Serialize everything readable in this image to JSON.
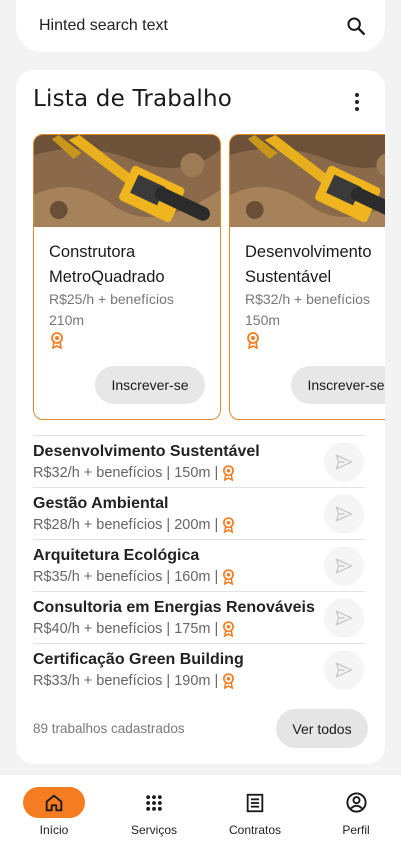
{
  "search": {
    "placeholder": "Hinted search text",
    "icon": "search-icon"
  },
  "panel": {
    "title": "Lista de Trabalho",
    "menu_icon": "more-vertical-icon",
    "featured": [
      {
        "title": "Construtora MetroQuadrado",
        "pay": "R$25/h + benefícios",
        "distance": "210m",
        "badge_icon": "award-icon",
        "apply_label": "Inscrever-se"
      },
      {
        "title": "Desenvolvimento Sustentável",
        "pay": "R$32/h + benefícios",
        "distance": "150m",
        "badge_icon": "award-icon",
        "apply_label": "Inscrever-se"
      }
    ],
    "jobs": [
      {
        "title": "Desenvolvimento Sustentável",
        "meta": "R$32/h + benefícios | 150m |"
      },
      {
        "title": "Gestão Ambiental",
        "meta": "R$28/h + benefícios | 200m |"
      },
      {
        "title": "Arquitetura Ecológica",
        "meta": "R$35/h + benefícios | 160m |"
      },
      {
        "title": "Consultoria em Energias Renováveis",
        "meta": "R$40/h + benefícios | 175m |"
      },
      {
        "title": "Certificação Green Building",
        "meta": "R$33/h + benefícios | 190m |"
      }
    ],
    "count_text": "89 trabalhos cadastrados",
    "see_all_label": "Ver todos"
  },
  "nav": {
    "items": [
      {
        "label": "Início",
        "icon": "home-icon",
        "active": true
      },
      {
        "label": "Serviços",
        "icon": "apps-grid-icon",
        "active": false
      },
      {
        "label": "Contratos",
        "icon": "document-list-icon",
        "active": false
      },
      {
        "label": "Perfil",
        "icon": "account-circle-icon",
        "active": false
      }
    ]
  },
  "colors": {
    "accent": "#f57c20",
    "card_border": "#e08a2b",
    "badge": "#f57c20"
  }
}
